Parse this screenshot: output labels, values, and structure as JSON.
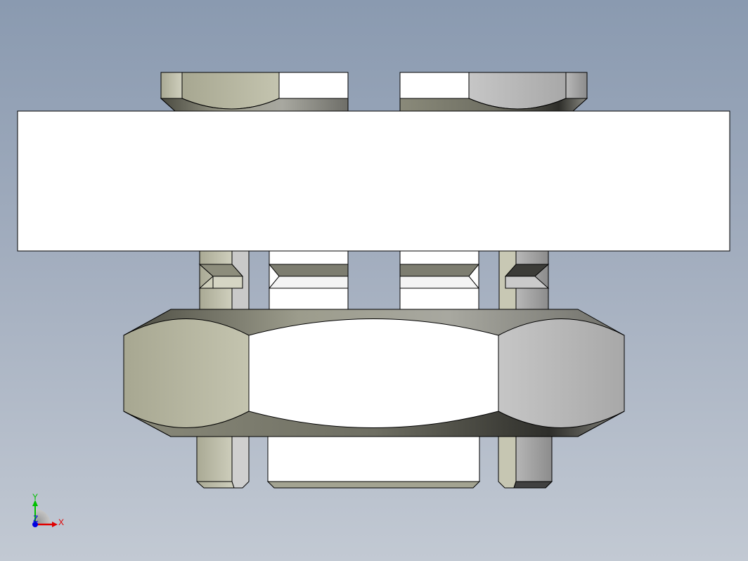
{
  "viewport": {
    "background_top": "#8a9ab0",
    "background_bottom": "#c2c9d3"
  },
  "model": {
    "part": "hex-nut-assembly",
    "colors": {
      "face_khaki": "#b9b9a3",
      "face_grey": "#bebebe",
      "face_white": "#ffffff",
      "chamfer_dark": "#7a7a6e",
      "edge": "#000000"
    }
  },
  "triad": {
    "x_label": "X",
    "y_label": "Y",
    "z_label": "Z",
    "x_color": "#e00000",
    "y_color": "#00c000",
    "z_color": "#0000e0"
  }
}
